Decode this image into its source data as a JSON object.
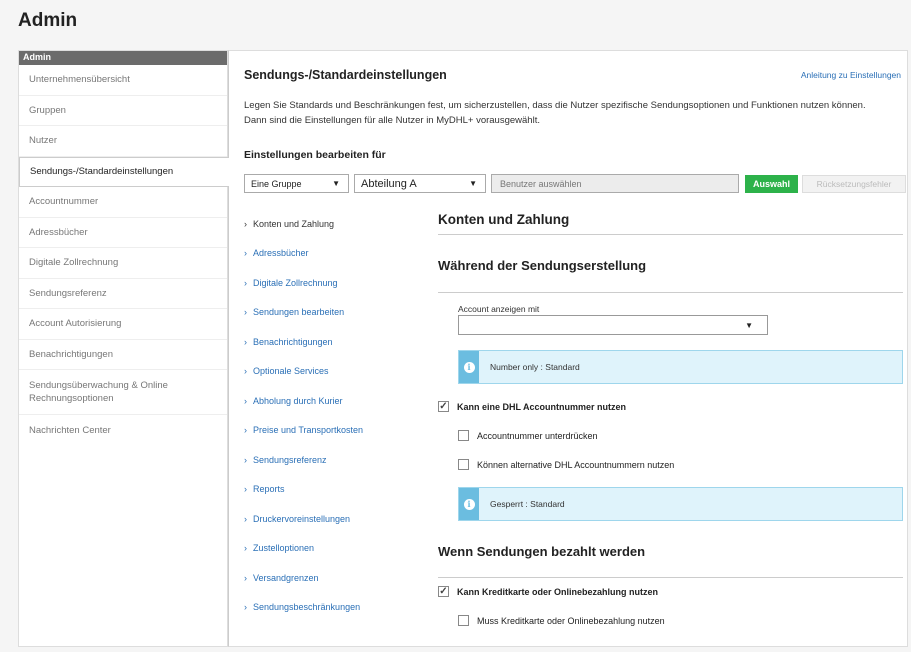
{
  "page": {
    "title": "Admin"
  },
  "sidebar": {
    "header": "Admin",
    "items": [
      {
        "label": "Unternehmensübersicht"
      },
      {
        "label": "Gruppen"
      },
      {
        "label": "Nutzer"
      },
      {
        "label": "Sendungs-/Standardeinstellungen"
      },
      {
        "label": "Accountnummer"
      },
      {
        "label": "Adressbücher"
      },
      {
        "label": "Digitale Zollrechnung"
      },
      {
        "label": "Sendungsreferenz"
      },
      {
        "label": "Account Autorisierung"
      },
      {
        "label": "Benachrichtigungen"
      },
      {
        "label": "Sendungsüberwachung & Online Rechnungsoptionen"
      },
      {
        "label": "Nachrichten Center"
      }
    ]
  },
  "main": {
    "title": "Sendungs-/Standardeinstellungen",
    "help_link": "Anleitung zu Einstellungen",
    "description": "Legen Sie Standards und Beschränkungen fest, um sicherzustellen, dass die Nutzer spezifische Sendungsoptionen und Funktionen nutzen können. Dann sind die Einstellungen für alle Nutzer in MyDHL+ vorausgewählt.",
    "edit_label": "Einstellungen bearbeiten für",
    "group_select": "Eine Gruppe",
    "department_select": "Abteilung A",
    "user_placeholder": "Benutzer auswählen",
    "select_button": "Auswahl",
    "reset_button": "Rücksetzungsfehler"
  },
  "section_nav": [
    {
      "label": "Konten und Zahlung"
    },
    {
      "label": "Adressbücher"
    },
    {
      "label": "Digitale Zollrechnung"
    },
    {
      "label": "Sendungen bearbeiten"
    },
    {
      "label": "Benachrichtigungen"
    },
    {
      "label": "Optionale Services"
    },
    {
      "label": "Abholung durch Kurier"
    },
    {
      "label": "Preise und Transportkosten"
    },
    {
      "label": "Sendungsreferenz"
    },
    {
      "label": "Reports"
    },
    {
      "label": "Druckervoreinstellungen"
    },
    {
      "label": "Zustelloptionen"
    },
    {
      "label": "Versandgrenzen"
    },
    {
      "label": "Sendungsbeschränkungen"
    }
  ],
  "content": {
    "section_title": "Konten und Zahlung",
    "subsection_1": "Während der Sendungserstellung",
    "account_label": "Account anzeigen mit",
    "account_value": "",
    "info_1": "Number only : Standard",
    "check_dhl_account": "Kann eine DHL Accountnummer nutzen",
    "check_suppress": "Accountnummer unterdrücken",
    "check_alternative": "Können alternative DHL Accountnummern nutzen",
    "info_2": "Gesperrt : Standard",
    "subsection_2": "Wenn Sendungen bezahlt werden",
    "check_credit_card": "Kann Kreditkarte oder Onlinebezahlung nutzen",
    "check_must_credit": "Muss Kreditkarte oder Onlinebezahlung nutzen"
  },
  "icons": {
    "check": "✓",
    "caret": "▼",
    "chevron": "›",
    "info": "i"
  },
  "colors": {
    "accent_green": "#2db24a",
    "link_blue": "#2a6fb6",
    "info_bg": "#dff3fb",
    "info_icon": "#6bbde0"
  }
}
